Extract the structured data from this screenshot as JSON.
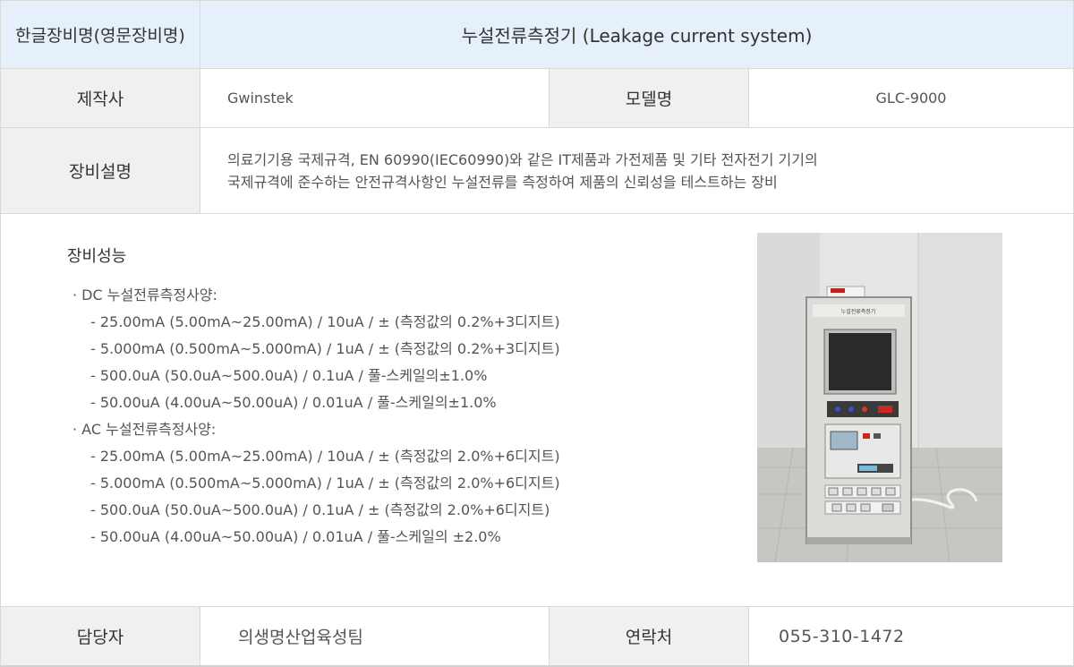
{
  "title_row": {
    "label": "한글장비명(영문장비명)",
    "value": "누설전류측정기 (Leakage current system)"
  },
  "maker_row": {
    "maker_label": "제작사",
    "maker_value": "Gwinstek",
    "model_label": "모델명",
    "model_value": "GLC-9000"
  },
  "desc_row": {
    "label": "장비설명",
    "lines": [
      "의료기기용 국제규격, EN 60990(IEC60990)와 같은 IT제품과 가전제품 및 기타 전자전기 기기의",
      "국제규격에 준수하는 안전규격사항인 누설전류를 측정하여 제품의 신뢰성을 테스트하는 장비"
    ]
  },
  "performance": {
    "title": "장비성능",
    "lines": [
      "· DC 누설전류측정사양:",
      "- 25.00mA (5.00mA~25.00mA) / 10uA / ± (측정값의 0.2%+3디지트)",
      "- 5.000mA (0.500mA~5.000mA) / 1uA / ± (측정값의 0.2%+3디지트)",
      "- 500.0uA (50.0uA~500.0uA) / 0.1uA / 풀-스케일의±1.0%",
      "- 50.00uA (4.00uA~50.00uA) / 0.01uA / 풀-스케일의±1.0%",
      "· AC 누설전류측정사양:",
      "- 25.00mA (5.00mA~25.00mA) / 10uA / ± (측정값의 2.0%+6디지트)",
      "- 5.000mA (0.500mA~5.000mA) / 1uA / ± (측정값의 2.0%+6디지트)",
      "- 500.0uA (50.0uA~500.0uA) / 0.1uA / ± (측정값의 2.0%+6디지트)",
      "- 50.00uA (4.00uA~50.00uA) / 0.01uA / 풀-스케일의 ±2.0%"
    ],
    "photo_panel_text": "누설전류측정기"
  },
  "contact_row": {
    "manager_label": "담당자",
    "manager_value": "의생명산업육성팀",
    "phone_label": "연락처",
    "phone_value": "055-310-1472"
  },
  "colors": {
    "title_bg": "#e6f0fb",
    "label_bg": "#f0f0f0",
    "border": "#d9d9d9"
  }
}
